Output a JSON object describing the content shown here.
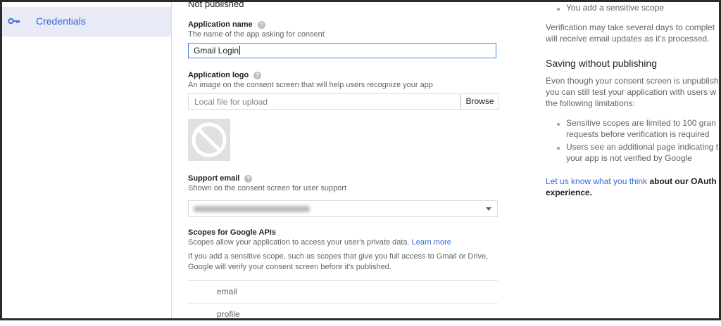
{
  "sidebar": {
    "credentials_label": "Credentials"
  },
  "form": {
    "status": "Not published",
    "app_name": {
      "label": "Application name",
      "description": "The name of the app asking for consent",
      "value": "Gmail Login"
    },
    "app_logo": {
      "label": "Application logo",
      "description": "An image on the consent screen that will help users recognize your app",
      "file_placeholder": "Local file for upload",
      "browse_label": "Browse"
    },
    "support_email": {
      "label": "Support email",
      "description": "Shown on the consent screen for user support"
    },
    "scopes": {
      "label": "Scopes for Google APIs",
      "description": "Scopes allow your application to access your user's private data.",
      "learn_more": "Learn more",
      "info_line1": "If you add a sensitive scope, such as scopes that give you full access to Gmail or Drive,",
      "info_line2": "Google will verify your consent screen before it's published.",
      "items": [
        "email",
        "profile"
      ]
    }
  },
  "right_panel": {
    "bullet_top": "You add a sensitive scope",
    "verification_line1": "Verification may take several days to complet",
    "verification_line2": "will receive email updates as it's processed.",
    "heading": "Saving without publishing",
    "para_line1": "Even though your consent screen is unpublish",
    "para_line2": "you can still test your application with users w",
    "para_line3": "the following limitations:",
    "limit1_line1": "Sensitive scopes are limited to 100 gran",
    "limit1_line2": "requests before verification is required",
    "limit2_line1": "Users see an additional page indicating t",
    "limit2_line2": "your app is not verified by Google",
    "feedback_link": "Let us know what you think",
    "feedback_rest_line1": "about our OAuth",
    "feedback_rest_line2": "experience."
  },
  "colors": {
    "accent": "#3367d6",
    "sidebar_active": "#e8eaf6",
    "focus_border": "#4285f4"
  }
}
